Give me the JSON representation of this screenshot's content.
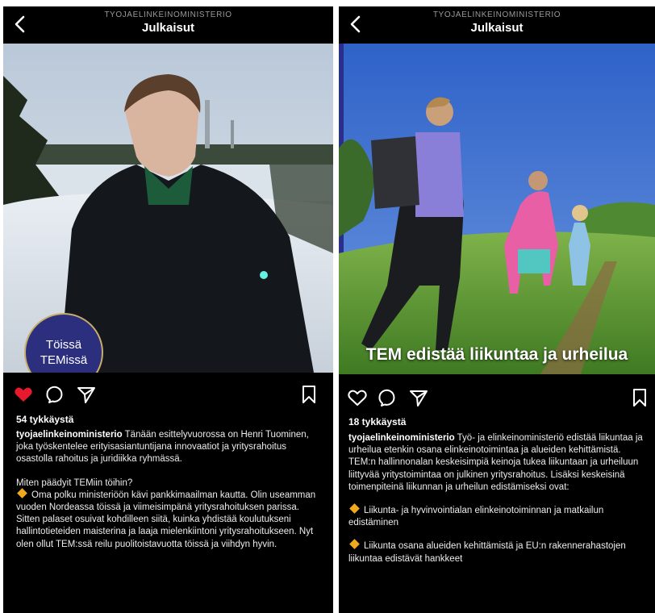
{
  "left_post": {
    "header_user": "TYOJAELINKEINOMINISTERIO",
    "header_title": "Julkaisut",
    "badge_lines": [
      "Töissä",
      "TEMissä"
    ],
    "liked": true,
    "likes": "54 tykkäystä",
    "username": "tyojaelinkeinoministerio",
    "caption_intro": "Tänään esittelyvuorossa on Henri Tuominen, joka työskentelee erityisasiantuntijana innovaatiot ja yritysrahoitus osastolla rahoitus ja juridiikka ryhmässä.",
    "question": "Miten päädyit TEMiin töihin?",
    "answer": "Oma polku ministeriöön kävi pankkimaailman kautta. Olin useamman vuoden Nordeassa töissä ja viimeisimpänä yritysrahoituksen parissa. Sitten palaset osuivat kohdilleen siitä, kuinka yhdistää koulutukseni hallintotieteiden maisterina ja laaja mielenkiintoni yritysrahoitukseen. Nyt olen ollut TEM:ssä reilu puolitoistavuotta töissä ja viihdyn hyvin."
  },
  "right_post": {
    "header_user": "TYOJAELINKEINOMINISTERIO",
    "header_title": "Julkaisut",
    "image_caption": "TEM edistää liikuntaa ja urheilua",
    "liked": false,
    "likes": "18 tykkäystä",
    "username": "tyojaelinkeinoministerio",
    "caption_intro": "Työ- ja elinkeinoministeriö edistää liikuntaa ja urheilua etenkin osana elinkeinotoimintaa ja alueiden kehittämistä. TEM:n hallinnonalan keskeisimpiä keinoja tukea liikuntaan ja urheiluun liittyvää yritystoimintaa on julkinen yritysrahoitus. Lisäksi keskeisinä toimenpiteinä liikunnan ja urheilun edistämiseksi ovat:",
    "bullet_1": "Liikunta- ja hyvinvointialan elinkeinotoiminnan ja matkailun edistäminen",
    "bullet_2": "Liikunta osana alueiden kehittämistä ja EU:n rakennerahastojen liikuntaa edistävät hankkeet"
  },
  "colors": {
    "background": "#000000",
    "heart_liked": "#e8192c",
    "bullet_diamond": "#f0a81c",
    "badge_fill": "#2c2f7e",
    "badge_ring": "#c9ad6a"
  },
  "icons": [
    "back-chevron-icon",
    "heart-icon",
    "comment-icon",
    "share-icon",
    "bookmark-icon"
  ]
}
